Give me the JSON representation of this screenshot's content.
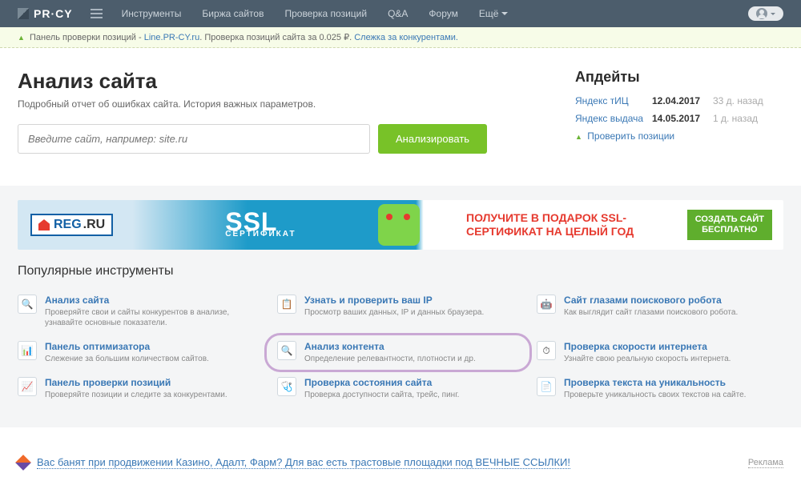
{
  "nav": {
    "logo": "PR·CY",
    "items": [
      "Инструменты",
      "Биржа сайтов",
      "Проверка позиций",
      "Q&A",
      "Форум"
    ],
    "more": "Ещё"
  },
  "promo": {
    "prefix": "Панель проверки позиций - ",
    "link": "Line.PR-CY.ru",
    "mid": ". Проверка позиций сайта за 0.025 ₽. ",
    "suffix": "Слежка за конкурентами."
  },
  "heading": "Анализ сайта",
  "subheading": "Подробный отчет об ошибках сайта. История важных параметров.",
  "input_placeholder": "Введите сайт, например: site.ru",
  "analyze_btn": "Анализировать",
  "updates": {
    "title": "Апдейты",
    "rows": [
      {
        "name": "Яндекс тИЦ",
        "date": "12.04.2017",
        "ago": "33 д. назад"
      },
      {
        "name": "Яндекс выдача",
        "date": "14.05.2017",
        "ago": "1 д. назад"
      }
    ],
    "check": "Проверить позиции"
  },
  "banner": {
    "reg": "REG",
    "ru": ".RU",
    "ssl": "SSL",
    "ssl_sub": "СЕРТИФИКАТ",
    "line1": "ПОЛУЧИТЕ В ПОДАРОК SSL-",
    "line2": "СЕРТИФИКАТ НА ЦЕЛЫЙ ГОД",
    "btn1": "СОЗДАТЬ САЙТ",
    "btn2": "БЕСПЛАТНО"
  },
  "popular": "Популярные инструменты",
  "tools": [
    {
      "icon": "🔍",
      "title": "Анализ сайта",
      "desc": "Проверяйте свои и сайты конкурентов в анализе, узнавайте основные показатели."
    },
    {
      "icon": "📋",
      "title": "Узнать и проверить ваш IP",
      "desc": "Просмотр ваших данных, IP и данных браузера."
    },
    {
      "icon": "🤖",
      "title": "Сайт глазами поискового робота",
      "desc": "Как выглядит сайт глазами поискового робота."
    },
    {
      "icon": "📊",
      "title": "Панель оптимизатора",
      "desc": "Слежение за большим количеством сайтов."
    },
    {
      "icon": "🔍",
      "title": "Анализ контента",
      "desc": "Определение релевантности, плотности и др."
    },
    {
      "icon": "⏱",
      "title": "Проверка скорости интернета",
      "desc": "Узнайте свою реальную скорость интернета."
    },
    {
      "icon": "📈",
      "title": "Панель проверки позиций",
      "desc": "Проверяйте позиции и следите за конкурентами."
    },
    {
      "icon": "🩺",
      "title": "Проверка состояния сайта",
      "desc": "Проверка доступности сайта, трейс, пинг."
    },
    {
      "icon": "📄",
      "title": "Проверка текста на уникальность",
      "desc": "Проверьте уникальность своих текстов на сайте."
    }
  ],
  "ad": {
    "text": "Вас банят при продвижении Казино, Адалт, Фарм? Для вас есть трастовые площадки под ВЕЧНЫЕ ССЫЛКИ!",
    "label": "Реклама"
  }
}
